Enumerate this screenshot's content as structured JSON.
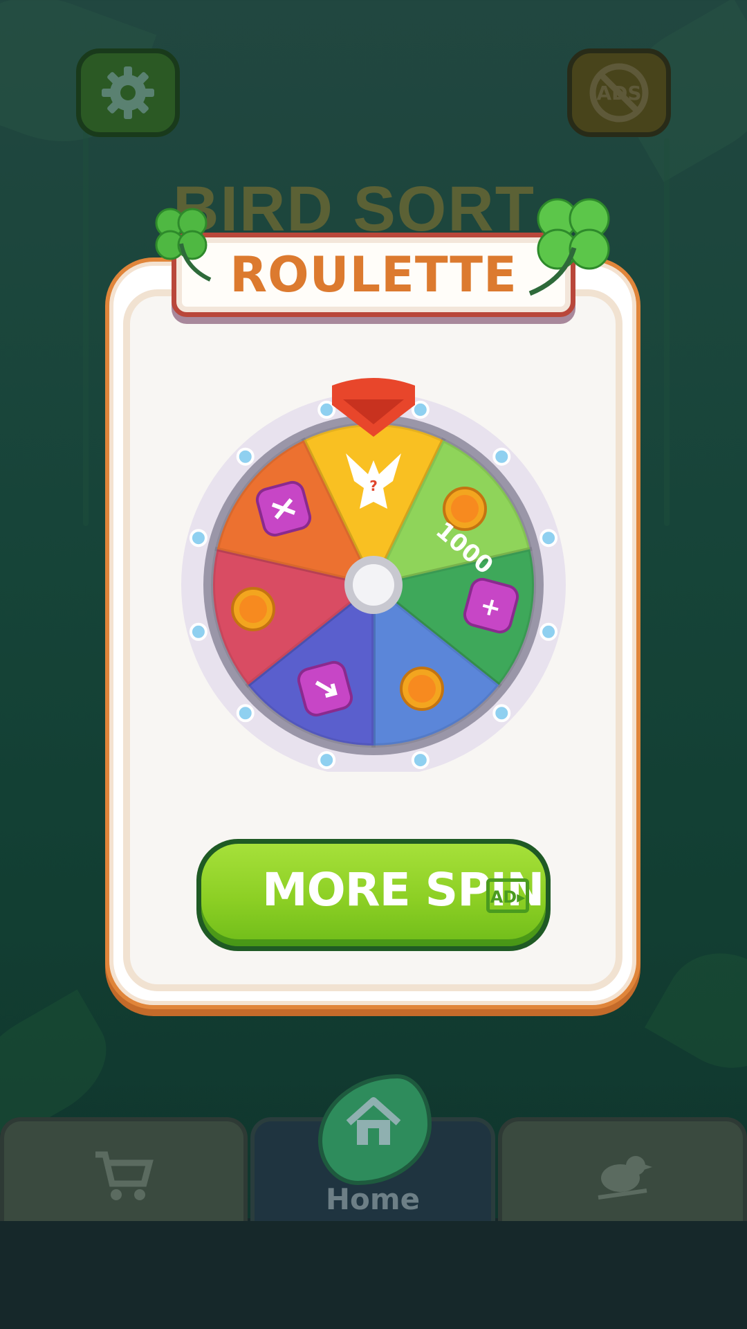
{
  "background_title": "BIRD SORT",
  "modal": {
    "title": "ROULETTE",
    "spin_button_label": "MORE SPIN",
    "spin_button_badge": "AD▸"
  },
  "top_bar": {
    "settings_icon": "gear-icon",
    "no_ads_label": "ADS"
  },
  "wheel": {
    "segments": [
      {
        "reward": "mystery-bird",
        "color": "#f9c022"
      },
      {
        "reward": "coins",
        "amount_label": "1000",
        "color": "#8fd45a"
      },
      {
        "reward": "add-branch-booster",
        "color": "#3ea85a"
      },
      {
        "reward": "coins",
        "color": "#5b86d9"
      },
      {
        "reward": "undo-booster",
        "color": "#5a5fcd"
      },
      {
        "reward": "coins",
        "color": "#d94c63"
      },
      {
        "reward": "shuffle-booster",
        "color": "#ec7130"
      }
    ],
    "rim_color": "#e6dfec",
    "pointer_color": "#e8462b"
  },
  "bottom_nav": {
    "tabs": [
      {
        "name": "shop",
        "icon": "cart-icon"
      },
      {
        "name": "home",
        "icon": "home-icon",
        "label": "Home"
      },
      {
        "name": "birds",
        "icon": "bird-icon"
      }
    ]
  }
}
